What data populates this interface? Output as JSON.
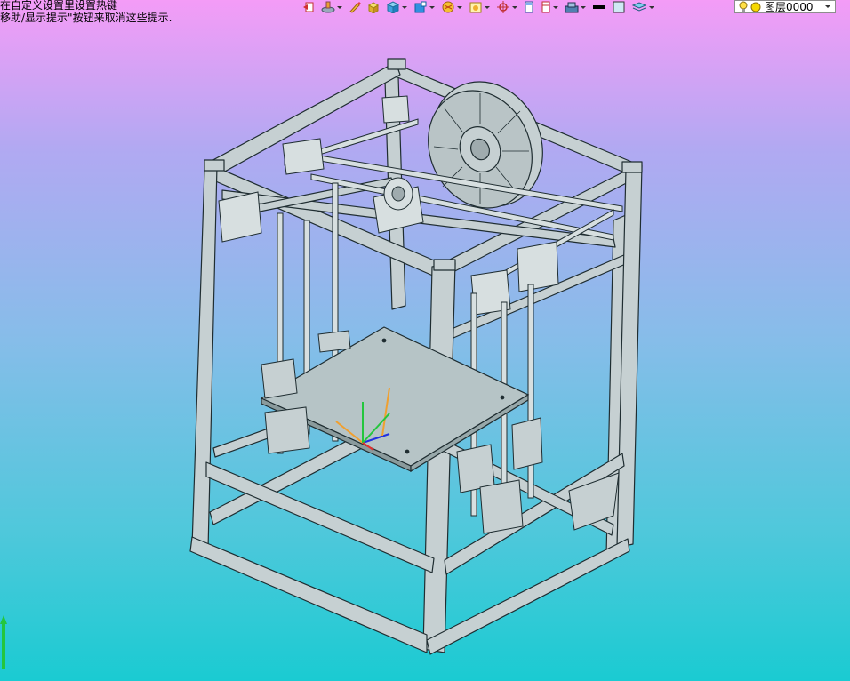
{
  "hints": {
    "line1": "在自定义设置里设置热键",
    "line2": "移助/显示提示\"按钮来取消这些提示."
  },
  "toolbar": {
    "icons": [
      "undo-icon",
      "stack-icon",
      "pencil-icon",
      "box-icon",
      "cube-icon",
      "view-cube-icon",
      "render-icon",
      "image-icon",
      "snap-icon",
      "document-icon",
      "frame-icon",
      "stamp-icon",
      "color-black-icon",
      "color-lightblue-icon",
      "layers-icon"
    ],
    "colors": {
      "black": "#000000",
      "lightblue": "#cfe8f4"
    }
  },
  "layer": {
    "name": "图层0000",
    "bulb_color": "#ffe046",
    "dot_color": "#f5d800"
  },
  "viewport": {
    "background_top": "#f49cf7",
    "background_bottom": "#1acbd2",
    "model_color": "#c6d0d2",
    "edge_color": "#1f2d31",
    "axes": {
      "x_color": "#2130e0",
      "y_color": "#24c63d",
      "z_color": "#f0a030"
    }
  }
}
